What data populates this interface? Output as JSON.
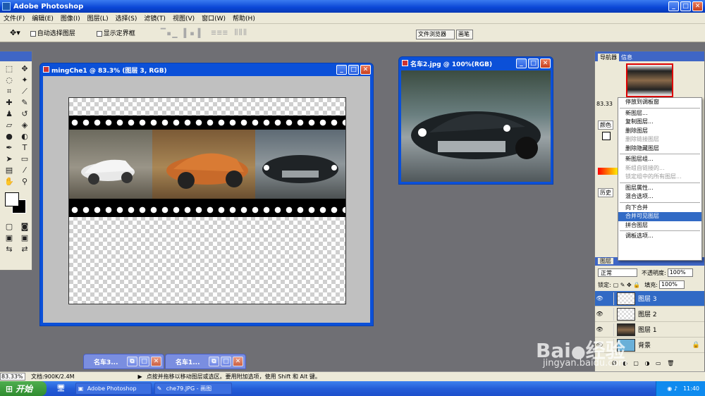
{
  "app": {
    "title": "Adobe Photoshop"
  },
  "menu": [
    "文件(F)",
    "编辑(E)",
    "图像(I)",
    "图层(L)",
    "选择(S)",
    "滤镜(T)",
    "视图(V)",
    "窗口(W)",
    "帮助(H)"
  ],
  "options": {
    "auto_select": "自动选择图层",
    "show_bounds": "显示定界框",
    "file_browser": "文件浏览器",
    "brushes": "画笔"
  },
  "doc_main": {
    "title": "mingChe1 @ 83.3% (图层 3, RGB)"
  },
  "doc_car2": {
    "title": "名车2.jpg @ 100%(RGB)"
  },
  "panels": {
    "navigator_tab": "导航器",
    "info_tab": "信息",
    "zoom": "83.33",
    "color_tab": "颜色",
    "history_tab": "历史",
    "layers_tab": "图层",
    "blend_mode": "正常",
    "opacity_label": "不透明度:",
    "opacity": "100%",
    "lock_label": "锁定:",
    "fill_label": "填充:",
    "fill": "100%"
  },
  "context_menu": [
    {
      "label": "停放到调板窗",
      "state": "normal"
    },
    {
      "label": "新图层...",
      "state": "normal"
    },
    {
      "label": "复制图层...",
      "state": "normal"
    },
    {
      "label": "删除图层",
      "state": "normal"
    },
    {
      "label": "删除链接图层",
      "state": "disabled"
    },
    {
      "label": "删除隐藏图层",
      "state": "normal"
    },
    {
      "label": "新图层组...",
      "state": "normal"
    },
    {
      "label": "新组自链接的...",
      "state": "disabled"
    },
    {
      "label": "锁定组中的所有图层...",
      "state": "disabled"
    },
    {
      "label": "图层属性...",
      "state": "normal"
    },
    {
      "label": "混合选项...",
      "state": "normal"
    },
    {
      "label": "向下合并",
      "state": "normal"
    },
    {
      "label": "合并可见图层",
      "state": "selected"
    },
    {
      "label": "拼合图层",
      "state": "normal"
    },
    {
      "label": "调板选项...",
      "state": "normal"
    }
  ],
  "layers": [
    {
      "name": "图层 3"
    },
    {
      "name": "图层 2"
    },
    {
      "name": "图层 1"
    },
    {
      "name": "背景"
    }
  ],
  "minimized": {
    "one": "名车3...",
    "two": "名车1..."
  },
  "status": {
    "zoom": "83.33%",
    "doc": "文档:900K/2.4M",
    "hint": "点按并拖移以移动图层或选区。要用附加选项，使用 Shift 和 Alt 键。"
  },
  "taskbar": {
    "start": "开始",
    "task1": "Adobe Photoshop",
    "task2": "che79.JPG - 画图",
    "clock": "11:40"
  },
  "watermark": {
    "brand": "Bai百经验",
    "url": "jingyan.baidu.com"
  },
  "colors": {
    "title_blue": "#0a46d6",
    "selection": "#316ac5",
    "workspace": "#6f6f74"
  }
}
